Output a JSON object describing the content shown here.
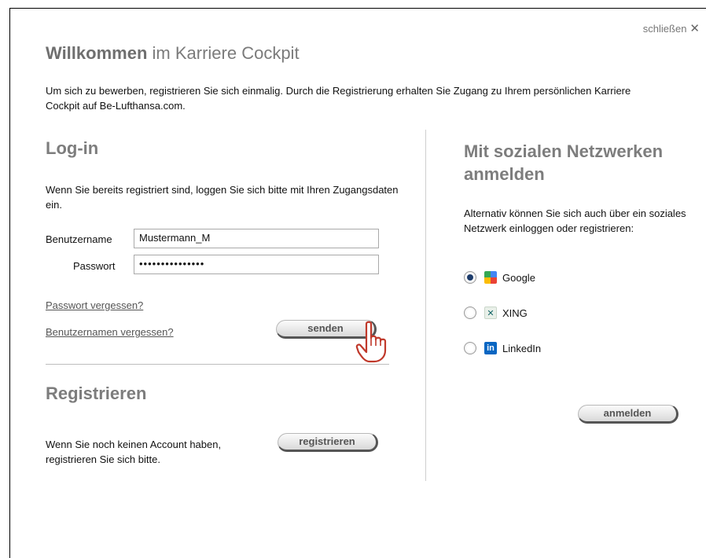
{
  "header": {
    "close_label": "schließen",
    "close_icon": "✕",
    "title_bold": "Willkommen",
    "title_rest": "im Karriere Cockpit",
    "intro": "Um sich zu bewerben, registrieren Sie sich einmalig. Durch die Registrierung erhalten Sie Zugang zu Ihrem persönlichen Karriere Cockpit auf Be-Lufthansa.com."
  },
  "login": {
    "heading": "Log-in",
    "description": "Wenn Sie bereits registriert sind, loggen Sie sich bitte mit Ihren Zugangsdaten ein.",
    "username_label": "Benutzername",
    "username_value": "Mustermann_M",
    "password_label": "Passwort",
    "password_value": "•••••••••••••••",
    "forgot_password": "Passwort vergessen?",
    "forgot_username": "Benutzernamen vergessen?",
    "submit_label": "senden"
  },
  "register": {
    "heading": "Registrieren",
    "description": "Wenn Sie noch keinen Account haben, registrieren Sie sich bitte.",
    "button_label": "registrieren"
  },
  "social": {
    "heading": "Mit sozialen Netzwerken anmelden",
    "description": "Alternativ können Sie sich auch über ein soziales Netzwerk einloggen oder registrieren:",
    "options": [
      {
        "label": "Google",
        "icon": "google-icon",
        "selected": true
      },
      {
        "label": "XING",
        "icon": "xing-icon",
        "selected": false
      },
      {
        "label": "LinkedIn",
        "icon": "linkedin-icon",
        "selected": false
      }
    ],
    "submit_label": "anmelden"
  },
  "colors": {
    "heading_gray": "#7d7d7d",
    "radio_selected": "#1d3c6b",
    "cursor_hand": "#c0392b"
  }
}
